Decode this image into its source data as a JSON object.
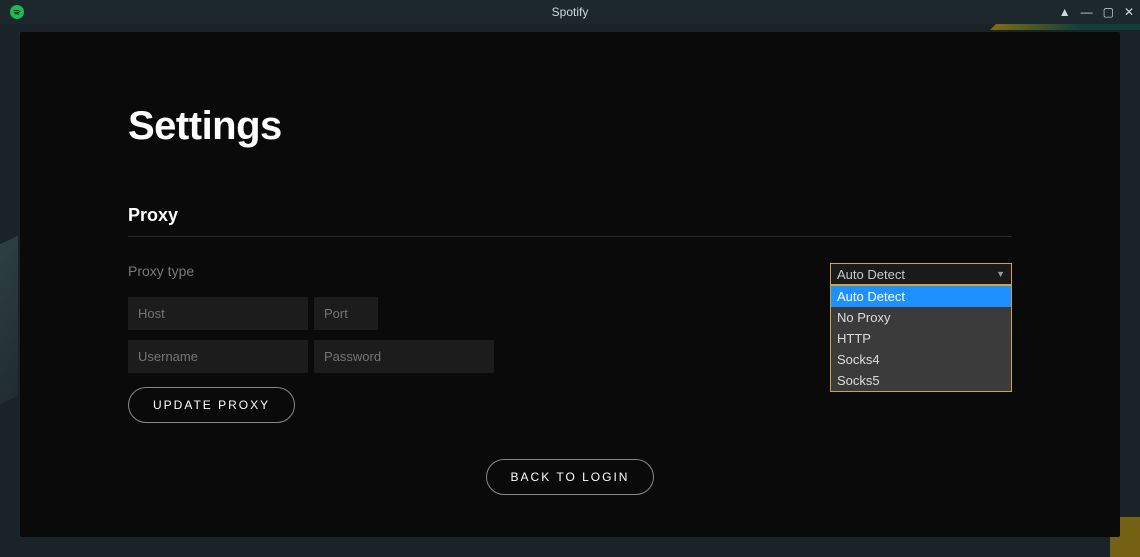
{
  "window": {
    "title": "Spotify"
  },
  "page": {
    "title": "Settings"
  },
  "section": {
    "title": "Proxy"
  },
  "proxy": {
    "type_label": "Proxy type",
    "select": {
      "value": "Auto Detect",
      "options": [
        "Auto Detect",
        "No Proxy",
        "HTTP",
        "Socks4",
        "Socks5"
      ]
    },
    "host_placeholder": "Host",
    "port_placeholder": "Port",
    "username_placeholder": "Username",
    "password_placeholder": "Password",
    "update_label": "UPDATE PROXY"
  },
  "footer": {
    "back_label": "BACK TO LOGIN"
  }
}
